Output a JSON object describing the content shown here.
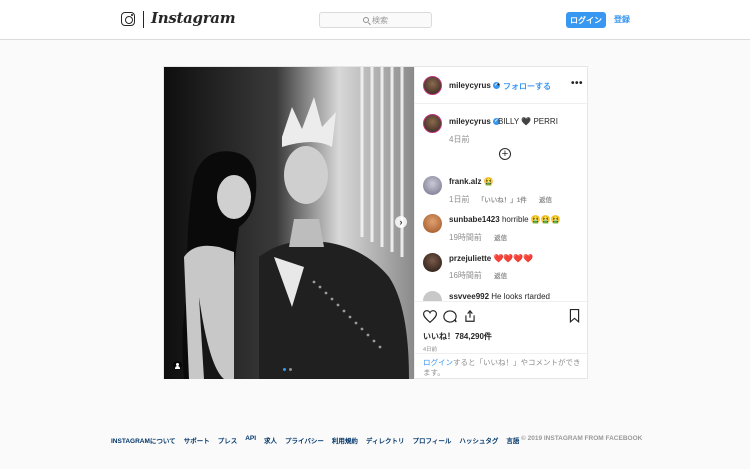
{
  "header": {
    "logo_text": "Instagram",
    "search_placeholder": "検索",
    "login_label": "ログイン",
    "signup_label": "登録"
  },
  "post": {
    "author": "mileycyrus",
    "follow_label": "フォローする",
    "separator": "•",
    "more_label": "•••",
    "caption": "BILLY 🖤 PERRI",
    "caption_time": "4日前",
    "photo_page": 1,
    "photo_count": 2,
    "likes": "いいね！784,290件",
    "date": "4日前",
    "login_prompt_link": "ログイン",
    "login_prompt_rest": "すると「いいね！」やコメントができます。"
  },
  "comments": [
    {
      "user": "frank.alz",
      "text": "🤮",
      "time": "1日前",
      "likes": "「いいね！」1件",
      "reply": "返信"
    },
    {
      "user": "sunbabe1423",
      "text": "horrible 🤮🤮🤮",
      "time": "19時間前",
      "likes": "",
      "reply": "返信"
    },
    {
      "user": "przejuliette",
      "text": "❤️❤️❤️❤️",
      "time": "16時間前",
      "likes": "",
      "reply": "返信"
    },
    {
      "user": "ssvvee992",
      "text": "He looks rtarded",
      "time": "",
      "likes": "",
      "reply": ""
    }
  ],
  "footer": {
    "links": [
      "INSTAGRAMについて",
      "サポート",
      "プレス",
      "API",
      "求人",
      "プライバシー",
      "利用規約",
      "ディレクトリ",
      "プロフィール",
      "ハッシュタグ",
      "言語"
    ],
    "copyright": "© 2019 INSTAGRAM FROM FACEBOOK"
  },
  "colors": {
    "accent": "#3897f0",
    "text": "#262626",
    "muted": "#8e8e8e",
    "background": "#fafafa",
    "border": "#dbdbdb"
  },
  "icons": [
    "instagram-glyph-icon",
    "search-icon",
    "verified-icon",
    "more-icon",
    "add-icon",
    "heart-icon",
    "comment-icon",
    "share-icon",
    "bookmark-icon",
    "next-arrow-icon",
    "user-tag-icon"
  ]
}
